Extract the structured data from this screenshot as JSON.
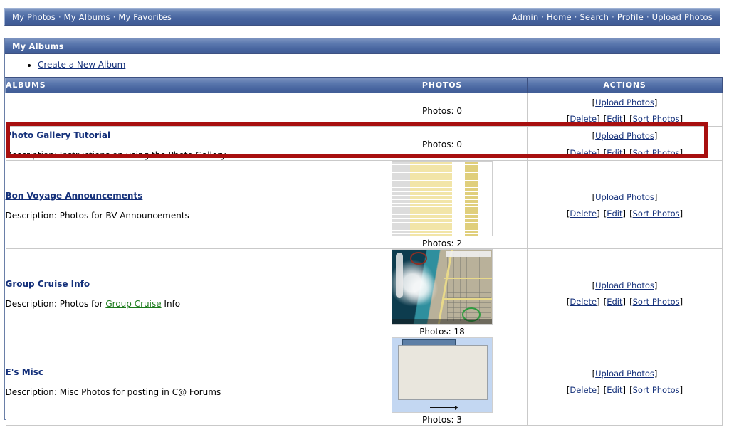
{
  "nav": {
    "left_items": [
      {
        "label": "My Photos"
      },
      {
        "label": "My Albums"
      },
      {
        "label": "My Favorites"
      }
    ],
    "right_items": [
      {
        "label": "Admin"
      },
      {
        "label": "Home"
      },
      {
        "label": "Search"
      },
      {
        "label": "Profile"
      },
      {
        "label": "Upload Photos"
      }
    ],
    "separator": "·"
  },
  "panel": {
    "title": "My Albums",
    "create_link": "Create a New Album"
  },
  "table": {
    "headers": {
      "albums": "ALBUMS",
      "photos": "PHOTOS",
      "actions": "ACTIONS"
    },
    "actions": {
      "upload": "Upload Photos",
      "delete": "Delete",
      "edit": "Edit",
      "sort": "Sort Photos",
      "open_bracket": "[",
      "close_bracket": "]"
    },
    "rows": [
      {
        "title": "",
        "description": "",
        "photo_count": "Photos: 0",
        "thumb": "none"
      },
      {
        "title": "Photo Gallery Tutorial",
        "description_label": "Description:",
        "description": "Instructions on using the Photo Gallery",
        "photo_count": "Photos: 0",
        "thumb": "none"
      },
      {
        "title": "Bon Voyage Announcements",
        "description_label": "Description:",
        "description": "Photos for BV Announcements",
        "photo_count": "Photos: 2",
        "thumb": "spreadsheet"
      },
      {
        "title": "Group Cruise Info",
        "description_label": "Description:",
        "description_pre": "Photos for",
        "description_link": "Group Cruise",
        "description_post": "Info",
        "photo_count": "Photos: 18",
        "thumb": "map"
      },
      {
        "title": "E's Misc",
        "description_label": "Description:",
        "description": "Misc Photos for posting in C@ Forums",
        "photo_count": "Photos: 3",
        "thumb": "ship"
      }
    ]
  },
  "highlight": {
    "color": "#a80f0f",
    "target": "Photo Gallery Tutorial row"
  },
  "colors": {
    "header_blue": "#46639e",
    "link_blue": "#14307a",
    "green_link": "#1a7a1a",
    "highlight_red": "#a80f0f"
  }
}
